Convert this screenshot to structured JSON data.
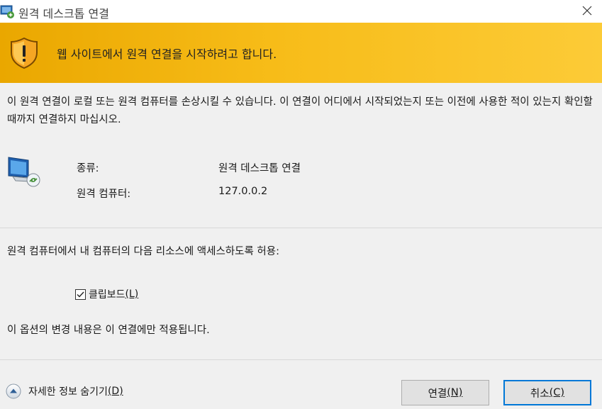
{
  "window": {
    "title": "원격 데스크톱 연결"
  },
  "banner": {
    "message": "웹 사이트에서 원격 연결을 시작하려고 합니다."
  },
  "warning": {
    "text": "이 원격 연결이 로컬 또는 원격 컴퓨터를 손상시킬 수 있습니다. 이 연결이 어디에서 시작되었는지 또는 이전에 사용한 적이 있는지 확인할 때까지 연결하지 마십시오."
  },
  "info": {
    "type_label": "종류:",
    "type_value": "원격 데스크톱 연결",
    "computer_label": "원격 컴퓨터:",
    "computer_value": "127.0.0.2"
  },
  "resources": {
    "heading": "원격 컴퓨터에서 내 컴퓨터의 다음 리소스에 액세스하도록 허용:",
    "clipboard_label": "클립보드",
    "clipboard_mnemonic": "(L)",
    "clipboard_checked": true,
    "note": "이 옵션의 변경 내용은 이 연결에만 적용됩니다."
  },
  "footer": {
    "details_label": "자세한 정보 숨기기",
    "details_mnemonic": "(D)",
    "connect_label": "연결",
    "connect_mnemonic": "(N)",
    "cancel_label": "취소",
    "cancel_mnemonic": "(C)"
  },
  "icons": {
    "app": "remote-desktop-icon",
    "close": "close-icon",
    "shield": "warning-shield-icon",
    "monitor": "remote-monitor-icon",
    "checkbox": "checkmark-icon",
    "toggle": "chevron-up-circle-icon"
  },
  "colors": {
    "banner_start": "#eaa700",
    "banner_end": "#fccb37",
    "default_button_border": "#0078d7"
  }
}
